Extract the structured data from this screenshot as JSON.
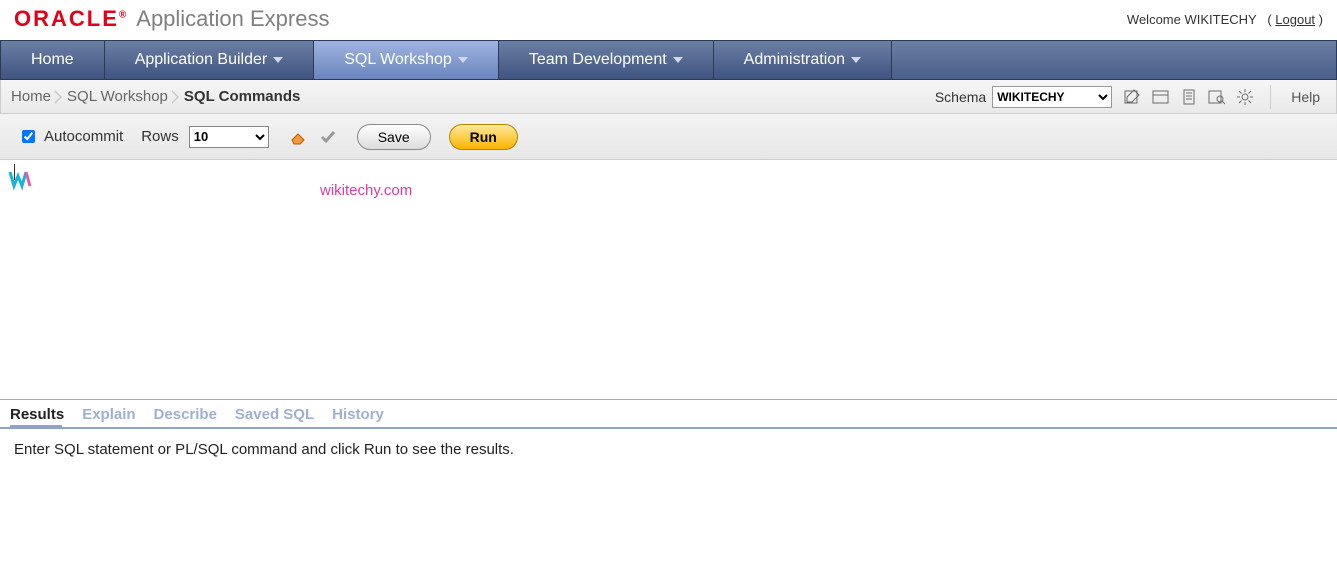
{
  "brand": {
    "logo_text": "ORACLE",
    "reg": "®",
    "app_title": "Application Express",
    "welcome_prefix": "Welcome ",
    "user": "WIKITECHY",
    "logout_open": "( ",
    "logout_label": "Logout",
    "logout_close": " )"
  },
  "nav": {
    "tabs": [
      {
        "label": "Home",
        "has_caret": false,
        "active": false
      },
      {
        "label": "Application Builder",
        "has_caret": true,
        "active": false
      },
      {
        "label": "SQL Workshop",
        "has_caret": true,
        "active": true
      },
      {
        "label": "Team Development",
        "has_caret": true,
        "active": false
      },
      {
        "label": "Administration",
        "has_caret": true,
        "active": false
      }
    ]
  },
  "breadcrumb": {
    "items": [
      {
        "label": "Home",
        "current": false
      },
      {
        "label": "SQL Workshop",
        "current": false
      },
      {
        "label": "SQL Commands",
        "current": true
      }
    ],
    "schema_label": "Schema",
    "schema_value": "WIKITECHY",
    "help_label": "Help"
  },
  "toolbar": {
    "autocommit_label": "Autocommit",
    "autocommit_checked": true,
    "rows_label": "Rows",
    "rows_value": "10",
    "save_label": "Save",
    "run_label": "Run"
  },
  "watermark": {
    "text": "wikitechy.com"
  },
  "results": {
    "tabs": [
      {
        "label": "Results",
        "active": true
      },
      {
        "label": "Explain",
        "active": false
      },
      {
        "label": "Describe",
        "active": false
      },
      {
        "label": "Saved SQL",
        "active": false
      },
      {
        "label": "History",
        "active": false
      }
    ],
    "message": "Enter SQL statement or PL/SQL command and click Run to see the results."
  }
}
